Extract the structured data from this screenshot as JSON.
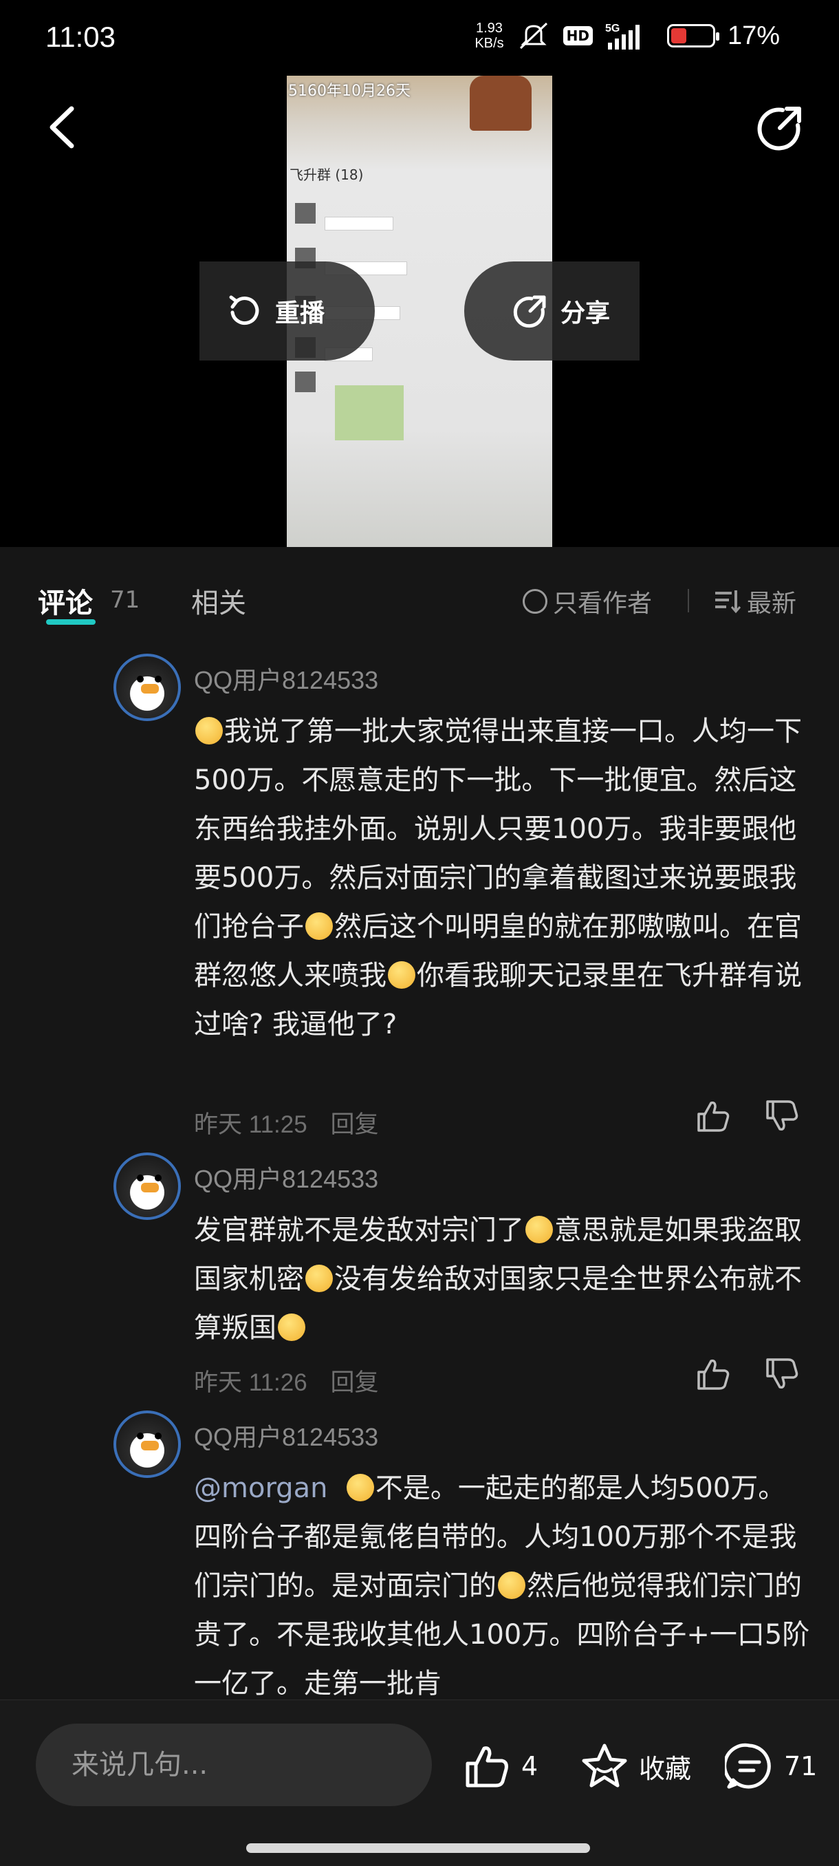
{
  "status_bar": {
    "time": "11:03",
    "net_speed_value": "1.93",
    "net_speed_unit": "KB/s",
    "hd": "HD",
    "signal": "5G",
    "battery_percent": "17%",
    "battery_level": 0.17
  },
  "video": {
    "replay_label": "重播",
    "share_label": "分享",
    "frame_date_text": "5160年10月26天",
    "frame_group_title": "飞升群 (18)"
  },
  "tabs": {
    "comments_label": "评论",
    "comments_count": "71",
    "related_label": "相关",
    "author_only_label": "只看作者",
    "sort_label": "最新"
  },
  "comments": [
    {
      "username": "QQ用户8124533",
      "text_parts": [
        "我说了第一批大家觉得出来直接一口。人均一下500万。不愿意走的下一批。下一批便宜。然后这东西给我挂外面。说别人只要100万。我非要跟他要500万。然后对面宗门的拿着截图过来说要跟我们抢台子",
        "然后这个叫明皇的就在那嗷嗷叫。在官群忽悠人来喷我",
        "你看我聊天记录里在飞升群有说过啥? 我逼他了?"
      ],
      "time": "昨天 11:25",
      "reply_label": "回复"
    },
    {
      "username": "QQ用户8124533",
      "text_parts": [
        "发官群就不是发敌对宗门了",
        "意思就是如果我盗取国家机密",
        "没有发给敌对国家只是全世界公布就不算叛国",
        ""
      ],
      "time": "昨天 11:26",
      "reply_label": "回复"
    },
    {
      "username": "QQ用户8124533",
      "mention": "@morgan",
      "text_parts": [
        "不是。一起走的都是人均500万。四阶台子都是氪佬自带的。人均100万那个不是我们宗门的。是对面宗门的",
        "然后他觉得我们宗门的贵了。不是我收其他人100万。四阶台子+一口5阶一亿了。走第一批肯"
      ]
    }
  ],
  "bottom_bar": {
    "input_placeholder": "来说几句...",
    "like_count": "4",
    "favorite_label": "收藏",
    "comment_count": "71"
  }
}
